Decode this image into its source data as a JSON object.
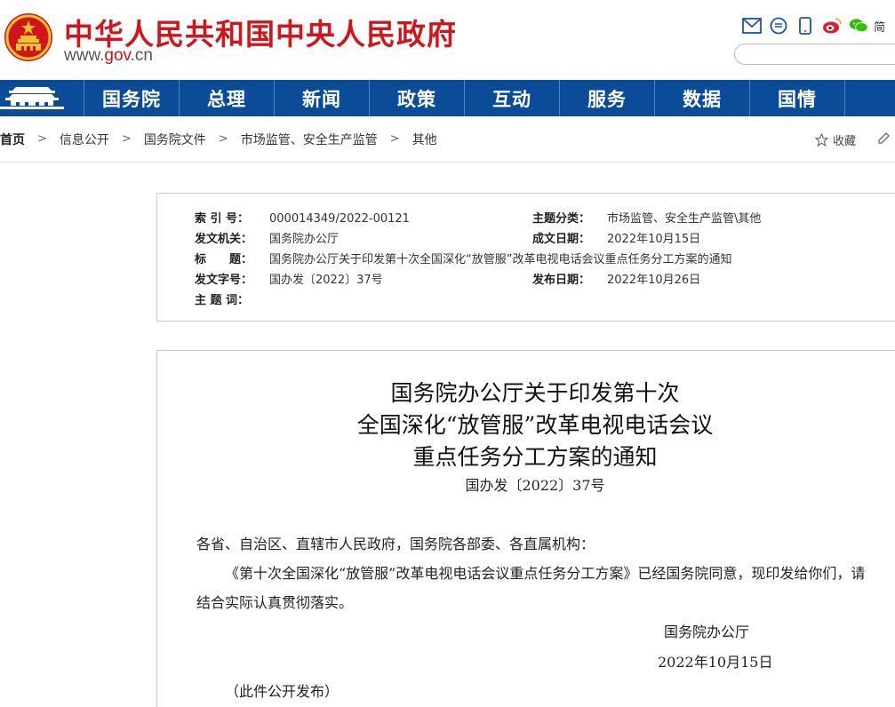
{
  "header": {
    "title": "中华人民共和国中央人民政府",
    "domain_prefix": "www.",
    "domain_accent": "gov",
    "domain_suffix": ".cn",
    "lang_label": "简",
    "search_placeholder": "",
    "icons": [
      "mail-icon",
      "message-icon",
      "mobile-icon",
      "weibo-icon",
      "wechat-icon"
    ]
  },
  "nav": {
    "items": [
      "国务院",
      "总理",
      "新闻",
      "政策",
      "互动",
      "服务",
      "数据",
      "国情"
    ]
  },
  "breadcrumb": {
    "items": [
      "首页",
      "信息公开",
      "国务院文件",
      "市场监管、安全生产监管",
      "其他"
    ],
    "separator": ">",
    "favorite_label": "收藏"
  },
  "meta": {
    "index_label": "索 引 号：",
    "index_value": "000014349/2022-00121",
    "category_label": "主题分类：",
    "category_value": "市场监管、安全生产监管\\其他",
    "issuer_label": "发文机关：",
    "issuer_value": "国务院办公厅",
    "written_label": "成文日期：",
    "written_value": "2022年10月15日",
    "title_label": "标　　题：",
    "title_value": "国务院办公厅关于印发第十次全国深化“放管服”改革电视电话会议重点任务分工方案的通知",
    "docno_label": "发文字号：",
    "docno_value": "国办发〔2022〕37号",
    "published_label": "发布日期：",
    "published_value": "2022年10月26日",
    "keywords_label": "主 题 词：",
    "keywords_value": ""
  },
  "document": {
    "title_line1": "国务院办公厅关于印发第十次",
    "title_line2": "全国深化“放管服”改革电视电话会议",
    "title_line3": "重点任务分工方案的通知",
    "number": "国办发〔2022〕37号",
    "salutation": "各省、自治区、直辖市人民政府，国务院各部委、各直属机构：",
    "paragraph": "《第十次全国深化“放管服”改革电视电话会议重点任务分工方案》已经国务院同意，现印发给你们，请结合实际认真贯彻落实。",
    "signer": "国务院办公厅",
    "date": "2022年10月15日",
    "note": "（此件公开发布）"
  },
  "colors": {
    "brand_red": "#d0161b",
    "nav_blue": "#0a4c97"
  }
}
